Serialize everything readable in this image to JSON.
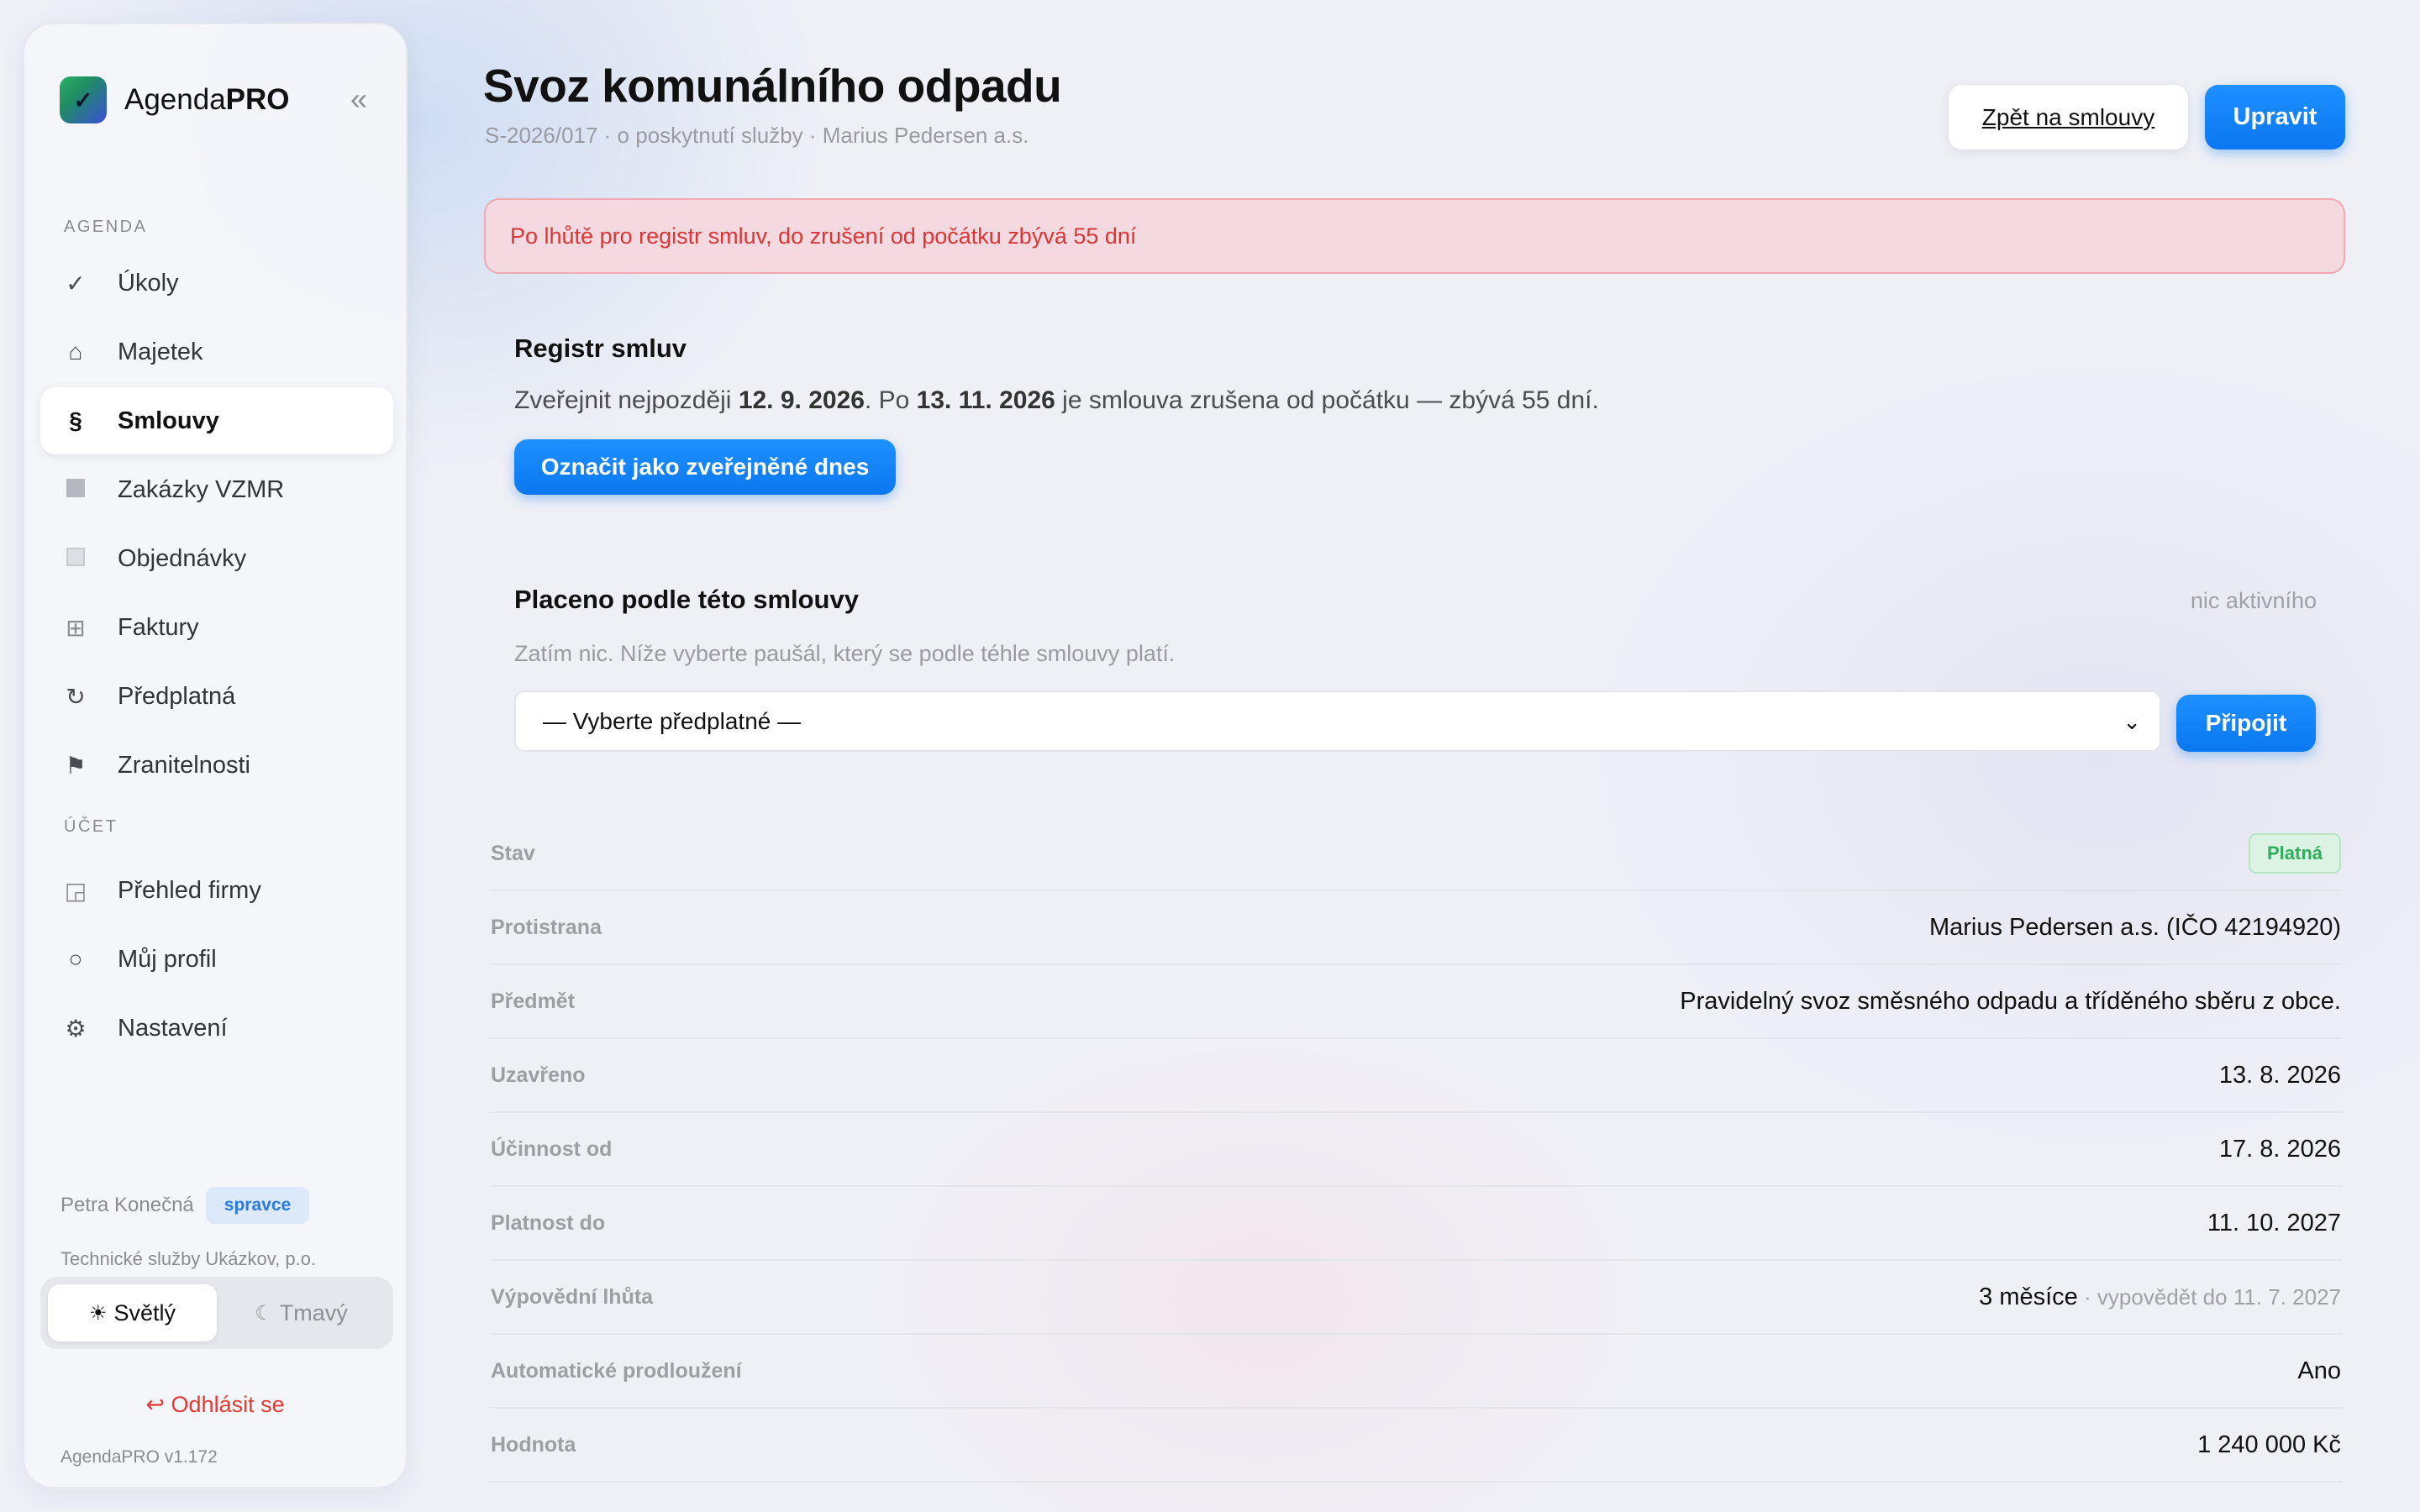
{
  "app": {
    "name_prefix": "Agenda",
    "name_bold": "PRO",
    "collapse_icon": "«",
    "version": "AgendaPRO v1.172"
  },
  "sidebar": {
    "agenda_label": "AGENDA",
    "agenda_items": [
      {
        "icon": "check-icon",
        "label": "Úkoly"
      },
      {
        "icon": "home-icon",
        "label": "Majetek"
      },
      {
        "icon": "section-icon",
        "label": "Smlouvy",
        "active": true
      },
      {
        "icon": "square-icon",
        "label": "Zakázky VZMR"
      },
      {
        "icon": "box-icon",
        "label": "Objednávky"
      },
      {
        "icon": "grid-icon",
        "label": "Faktury"
      },
      {
        "icon": "refresh-icon",
        "label": "Předplatná"
      },
      {
        "icon": "flag-icon",
        "label": "Zranitelnosti"
      }
    ],
    "account_label": "ÚČET",
    "account_items": [
      {
        "icon": "dashboard-icon",
        "label": "Přehled firmy"
      },
      {
        "icon": "profile-icon",
        "label": "Můj profil"
      },
      {
        "icon": "gear-icon",
        "label": "Nastavení"
      }
    ],
    "user": {
      "name": "Petra Konečná",
      "role": "spravce",
      "org": "Technické služby Ukázkov, p.o."
    },
    "theme": {
      "light": "Světlý",
      "dark": "Tmavý",
      "selected": "light"
    },
    "logout": "Odhlásit se"
  },
  "header": {
    "title": "Svoz komunálního odpadu",
    "subtitle": "S-2026/017 · o poskytnutí služby · Marius Pedersen a.s.",
    "back_button": "Zpět na smlouvy",
    "edit_button": "Upravit"
  },
  "alert": "Po lhůtě pro registr smluv, do zrušení od počátku zbývá 55 dní",
  "registry": {
    "title": "Registr smluv",
    "text_1": "Zveřejnit nejpozději ",
    "publish_by": "12. 9. 2026",
    "text_2": ". Po ",
    "void_date": "13. 11. 2026",
    "text_3": " je smlouva zrušena od počátku — zbývá 55 dní.",
    "button": "Označit jako zveřejněné dnes"
  },
  "paid": {
    "title": "Placeno podle této smlouvy",
    "status": "nic aktivního",
    "empty": "Zatím nic. Níže vyberte paušál, který se podle téhle smlouvy platí.",
    "select_value": "— Vyberte předplatné —",
    "attach_button": "Připojit"
  },
  "details": {
    "status": {
      "label": "Stav",
      "value": "Platná",
      "color": "#2eae5c"
    },
    "rows": [
      {
        "label": "Protistrana",
        "value": "Marius Pedersen a.s. (IČO 42194920)"
      },
      {
        "label": "Předmět",
        "value": "Pravidelný svoz směsného odpadu a tříděného sběru z obce."
      },
      {
        "label": "Uzavřeno",
        "value": "13. 8. 2026"
      },
      {
        "label": "Účinnost od",
        "value": "17. 8. 2026"
      },
      {
        "label": "Platnost do",
        "value": "11. 10. 2027"
      }
    ],
    "notice": {
      "label": "Výpovědní lhůta",
      "value": "3 měsíce",
      "note": " · vypovědět do 11. 7. 2027"
    },
    "rows2": [
      {
        "label": "Automatické prodloužení",
        "value": "Ano"
      },
      {
        "label": "Hodnota",
        "value": "1 240 000 Kč"
      }
    ]
  },
  "colors": {
    "accent": "#0a77f0",
    "danger": "#e53935",
    "alert_bg": "#f4d9e0"
  }
}
